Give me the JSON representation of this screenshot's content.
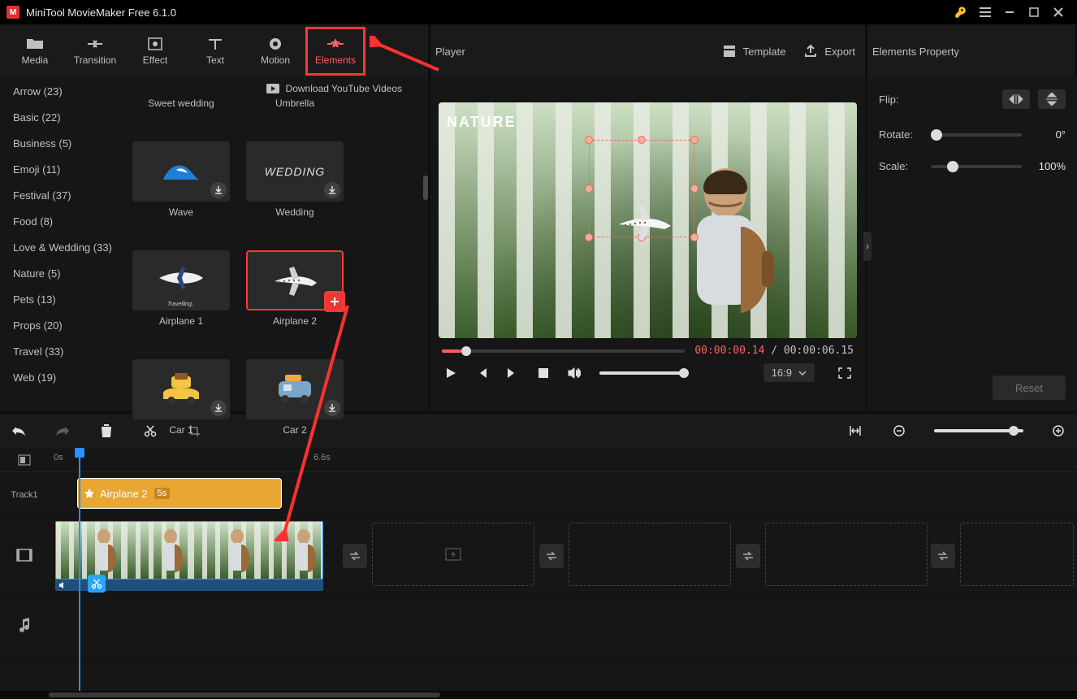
{
  "app": {
    "title": "MiniTool MovieMaker Free 6.1.0"
  },
  "tabs": {
    "media": "Media",
    "transition": "Transition",
    "effect": "Effect",
    "text": "Text",
    "motion": "Motion",
    "elements": "Elements"
  },
  "player_header": {
    "label": "Player",
    "template": "Template",
    "export": "Export"
  },
  "prop_header": {
    "label": "Elements Property"
  },
  "categories": [
    {
      "label": "Arrow (23)"
    },
    {
      "label": "Basic (22)"
    },
    {
      "label": "Business (5)"
    },
    {
      "label": "Emoji (11)"
    },
    {
      "label": "Festival (37)"
    },
    {
      "label": "Food (8)"
    },
    {
      "label": "Love & Wedding (33)"
    },
    {
      "label": "Nature (5)"
    },
    {
      "label": "Pets (13)"
    },
    {
      "label": "Props (20)"
    },
    {
      "label": "Travel (33)"
    },
    {
      "label": "Web (19)"
    }
  ],
  "yt_download": "Download YouTube Videos",
  "thumbs": [
    {
      "label": "Sweet wedding",
      "kind": "label-only"
    },
    {
      "label": "Umbrella",
      "kind": "label-only"
    },
    {
      "label": "Wave",
      "kind": "wave",
      "dl": true
    },
    {
      "label": "Wedding",
      "kind": "wedding",
      "dl": true
    },
    {
      "label": "Airplane 1",
      "kind": "plane1"
    },
    {
      "label": "Airplane 2",
      "kind": "plane2",
      "selected": true,
      "add": true
    },
    {
      "label": "Car 1",
      "kind": "car1",
      "dl": true
    },
    {
      "label": "Car 2",
      "kind": "car2",
      "dl": true
    }
  ],
  "player": {
    "nature_text": "NATURE",
    "time_current": "00:00:00.14",
    "time_sep": "/",
    "time_total": "00:00:06.15",
    "aspect": "16:9"
  },
  "prop": {
    "flip": "Flip:",
    "rotate": "Rotate:",
    "rotate_val": "0°",
    "scale": "Scale:",
    "scale_val": "100%",
    "reset": "Reset"
  },
  "timeline": {
    "ruler_start": "0s",
    "ruler_end": "6.6s",
    "track1": "Track1",
    "clip_name": "Airplane 2",
    "clip_dur": "5s"
  }
}
